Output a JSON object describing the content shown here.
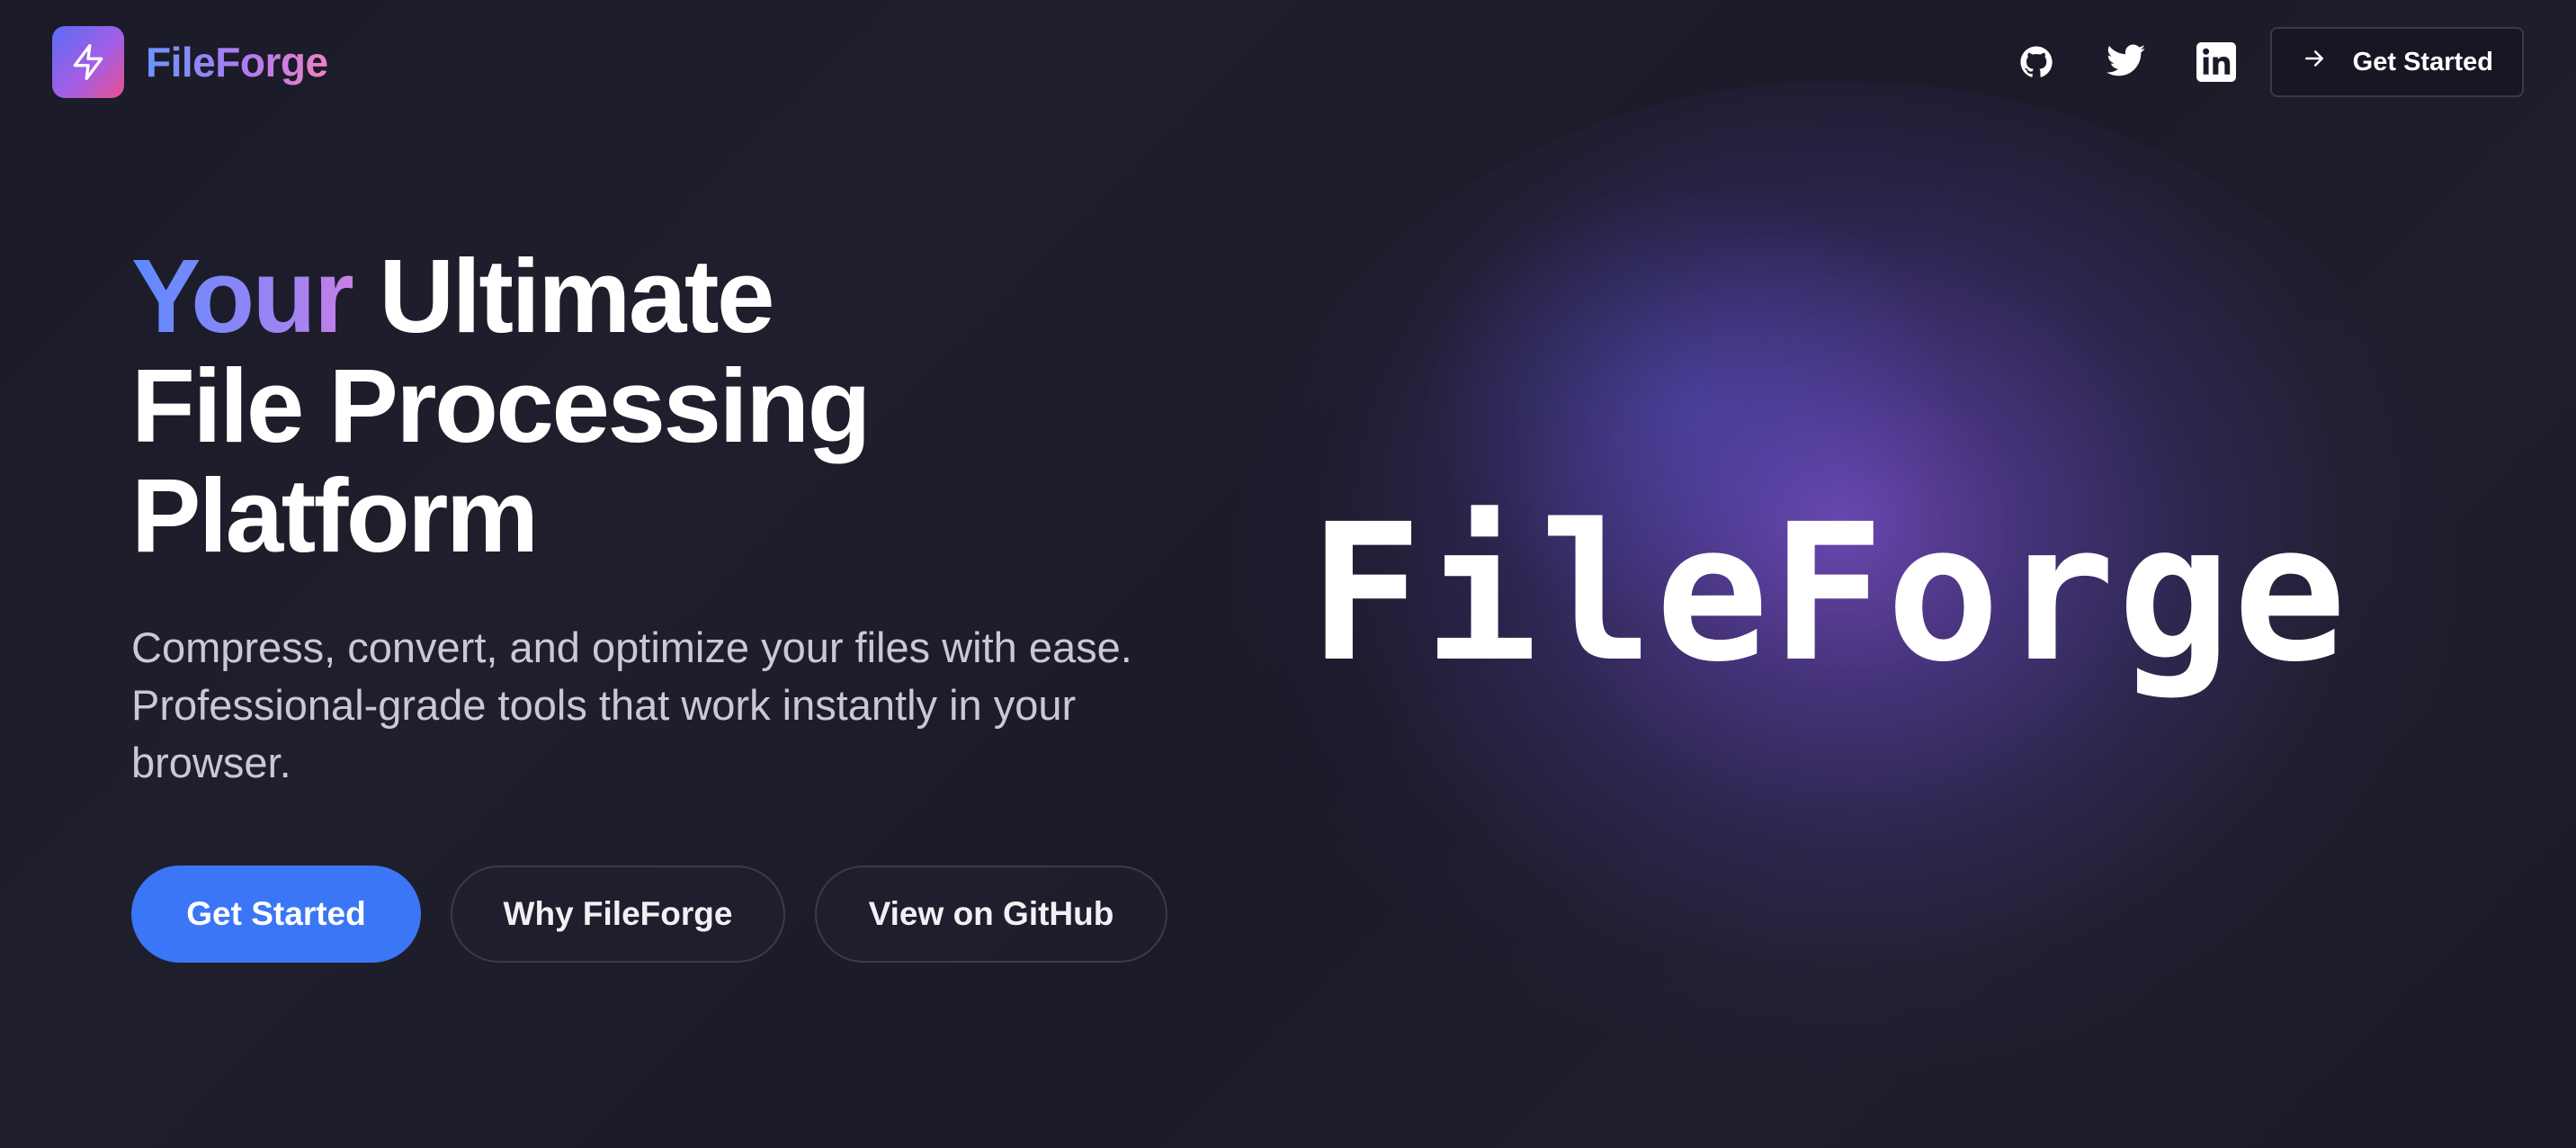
{
  "brand": {
    "name": "FileForge",
    "logo_icon": "lightning-bolt-icon",
    "gradient_colors": [
      "#5b6cf5",
      "#a35ee6",
      "#e8508f"
    ]
  },
  "nav": {
    "social": [
      {
        "name": "github-icon",
        "label": "GitHub"
      },
      {
        "name": "twitter-icon",
        "label": "Twitter"
      },
      {
        "name": "linkedin-icon",
        "label": "LinkedIn"
      }
    ],
    "cta_icon": "arrow-right-icon",
    "cta_label": "Get Started"
  },
  "hero": {
    "headline_highlight": "Your",
    "headline_rest_line1": "Ultimate",
    "headline_line2": "File Processing",
    "headline_line3": "Platform",
    "subtext": "Compress, convert, and optimize your files with ease. Professional-grade tools that work instantly in your browser.",
    "buttons": {
      "primary": "Get Started",
      "secondary": "Why FileForge",
      "tertiary": "View on GitHub"
    },
    "wordmark": "FileForge"
  },
  "colors": {
    "background": "#1b1a28",
    "primary_button": "#3b76f6",
    "glow": "#7c50cd"
  }
}
